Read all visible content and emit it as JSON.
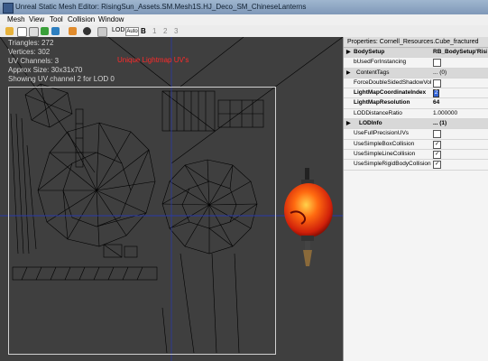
{
  "window": {
    "title": "Unreal Static Mesh Editor: RisingSun_Assets.SM.Mesh1S.HJ_Deco_SM_ChineseLanterns"
  },
  "menu": [
    "Mesh",
    "View",
    "Tool",
    "Collision",
    "Window"
  ],
  "toolbar": {
    "lod_label": "LOD:",
    "lod_auto": "Auto",
    "lod_base": "B",
    "lod_1": "1",
    "lod_2": "2",
    "lod_3": "3"
  },
  "viewport": {
    "stats": [
      "Triangles:  272",
      "Vertices:  302",
      "UV Channels:  3",
      "Approx Size:  30x31x70",
      "Showing UV channel 2 for LOD 0"
    ],
    "uv_overlay_title": "Unique Lightmap UV's"
  },
  "properties": {
    "header": "Properties: Cornell_Resources.Cube_fractured",
    "rows": [
      {
        "name": "BodySetup",
        "value": "RB_BodySetup'Risin",
        "kind": "category"
      },
      {
        "name": "bUsedForInstancing",
        "checked": false,
        "kind": "check"
      },
      {
        "name": "ContentTags",
        "value": "... (0)",
        "kind": "category"
      },
      {
        "name": "ForceDoubleSidedShadowVolume",
        "checked": false,
        "kind": "check"
      },
      {
        "name": "LightMapCoordinateIndex",
        "value": "2",
        "kind": "edit"
      },
      {
        "name": "LightMapResolution",
        "value": "64",
        "kind": "bold"
      },
      {
        "name": "LODDistanceRatio",
        "value": "1.000000",
        "kind": "text"
      },
      {
        "name": "LODInfo",
        "value": "... (1)",
        "kind": "category"
      },
      {
        "name": "UseFullPrecisionUVs",
        "checked": false,
        "kind": "check"
      },
      {
        "name": "UseSimpleBoxCollision",
        "checked": true,
        "kind": "check"
      },
      {
        "name": "UseSimpleLineCollision",
        "checked": true,
        "kind": "check"
      },
      {
        "name": "UseSimpleRigidBodyCollision",
        "checked": true,
        "kind": "check"
      }
    ]
  },
  "colors": {
    "uv_lines": "#000000",
    "axis": "#2a3aa8",
    "uv_title": "#ff2a2a",
    "lantern": "#ff4a10"
  }
}
